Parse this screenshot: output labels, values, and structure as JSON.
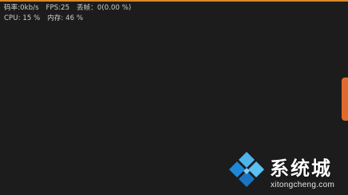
{
  "stats": {
    "bitrate": "码率:0kb/s",
    "fps": "FPS:25",
    "dropped": "丢帧：0(0.00 %)",
    "cpu": "CPU: 15 %",
    "memory": "内存: 46 %"
  },
  "watermark": {
    "title": "系统城",
    "domain": "xitongcheng.com",
    "logo_icon": "windows-diamond-logo-icon"
  },
  "colors": {
    "background": "#1c1c1c",
    "accent_orange": "#e06a2c",
    "stats_text": "#cfcfcf",
    "logo_blue": "#1e88d8"
  }
}
